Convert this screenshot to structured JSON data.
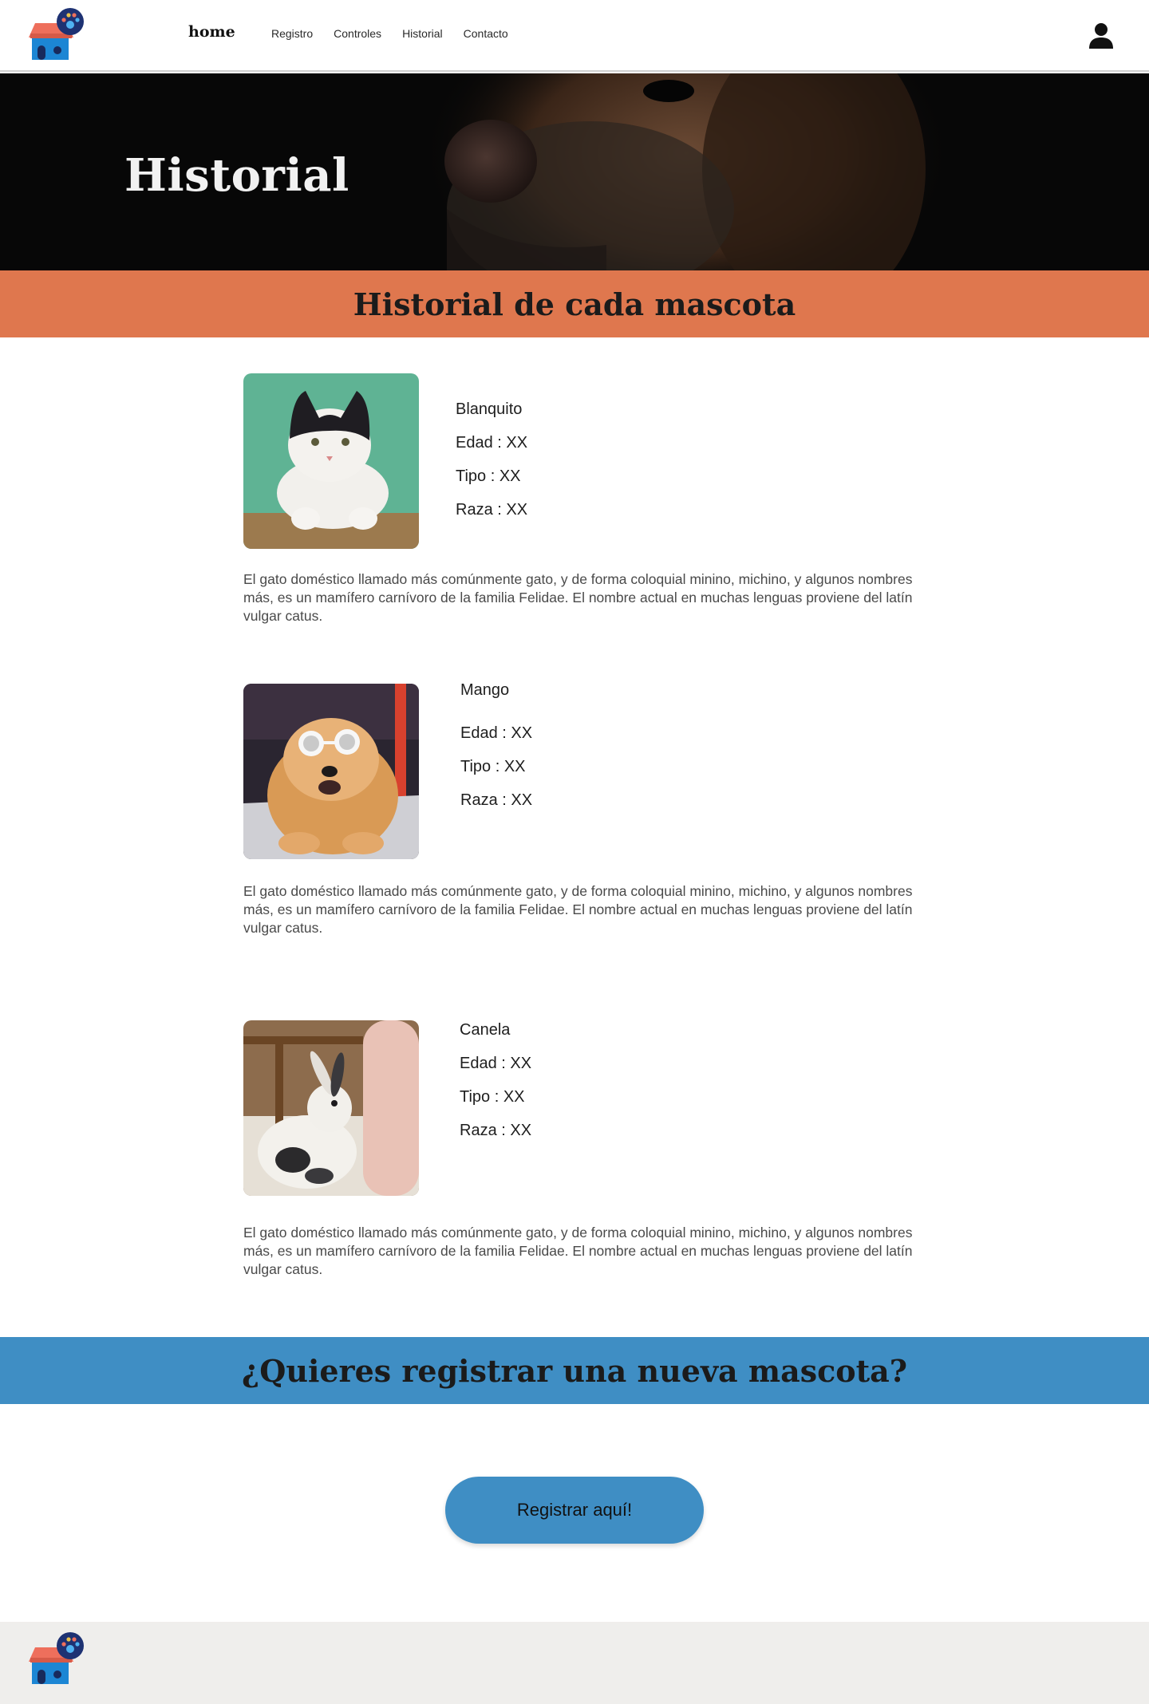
{
  "header": {
    "logo_icon": "pet-house-logo-icon",
    "nav_home": "home",
    "nav_links": [
      "Registro",
      "Controles",
      "Historial",
      "Contacto"
    ],
    "user_icon": "user-account-icon"
  },
  "hero": {
    "title": "Historial",
    "image": "dog-closeup-photo"
  },
  "history_section": {
    "title": "Historial de cada mascota"
  },
  "pets": [
    {
      "name": "Blanquito",
      "edad": "Edad : XX",
      "tipo": "Tipo : XX",
      "raza": "Raza : XX",
      "photo": "cat-photo",
      "description": "El gato doméstico llamado más comúnmente gato, y de forma coloquial minino,  michino,  y algunos nombres más, es un mamífero carnívoro de la familia Felidae. El nombre actual en muchas lenguas proviene del latín vulgar catus."
    },
    {
      "name": "Mango",
      "edad": "Edad : XX",
      "tipo": "Tipo : XX",
      "raza": "Raza : XX",
      "photo": "dog-with-sunglasses-photo",
      "description": "El gato doméstico llamado más comúnmente gato, y de forma coloquial minino,  michino,  y algunos nombres más, es un mamífero carnívoro de la familia Felidae. El nombre actual en muchas lenguas proviene del latín vulgar catus."
    },
    {
      "name": "Canela",
      "edad": "Edad : XX",
      "tipo": "Tipo : XX",
      "raza": "Raza : XX",
      "photo": "rabbit-photo",
      "description": "El gato doméstico llamado más comúnmente gato, y de forma coloquial minino,  michino,  y algunos nombres más, es un mamífero carnívoro de la familia Felidae. El nombre actual en muchas lenguas proviene del latín vulgar catus."
    }
  ],
  "register_section": {
    "title": "¿Quieres registrar una nueva mascota?",
    "button_label": "Registrar aquí!"
  },
  "colors": {
    "orange_band": "#df774e",
    "blue_band": "#3f8ec4",
    "footer_bg": "#efeeec"
  }
}
